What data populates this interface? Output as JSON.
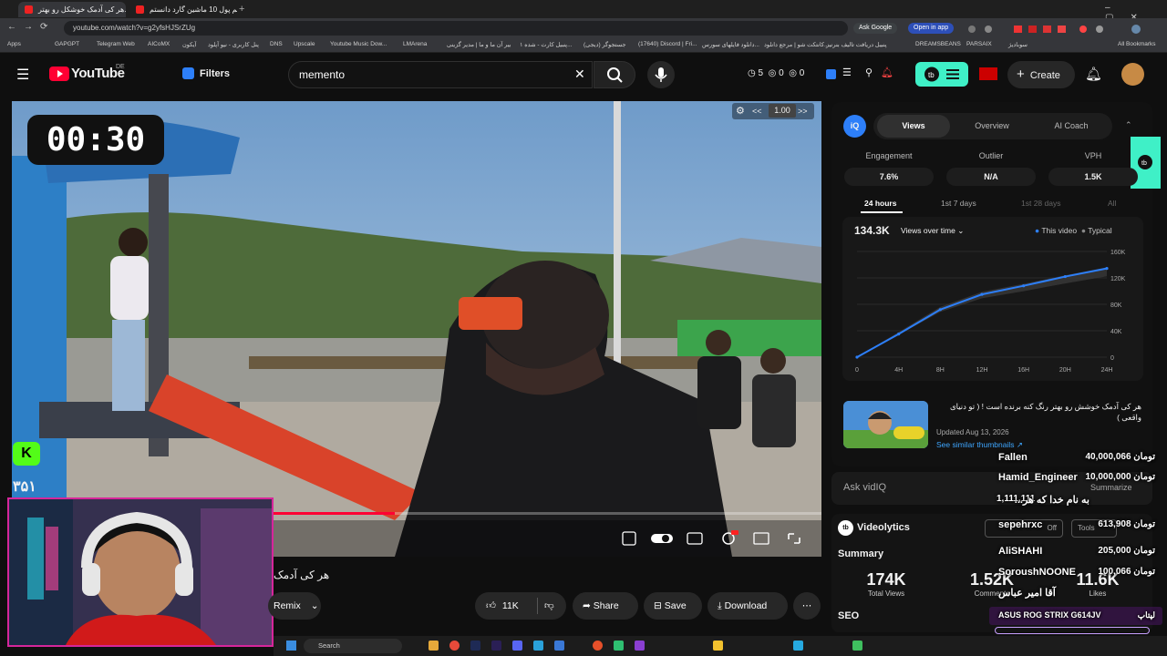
{
  "browser": {
    "tabs": [
      "هر کی آدمک خوشکل رو بهتر...",
      "بیم پول 10 ماشین گارد دانستم ..."
    ],
    "url": "youtube.com/watch?v=g2yfsHJSrZUg",
    "chips": {
      "ask_google": "Ask Google",
      "open_app": "Open in app"
    },
    "bookmarks": [
      "Apps",
      "GAPGPT",
      "Telegram Web",
      "AICoMX",
      "آیکون",
      "پنل کاربری - نیو آپلود",
      "DNS",
      "Upscale",
      "Youtube Music Dow...",
      "LMArena",
      "بیر آن ما و ما | مدیر گزینی",
      "پنبیل کارت - شده ۱...",
      "جستجوگر (دیجی)",
      "(17640) Discord | Fri...",
      "دانلود فایلهای سورس...",
      "کانتکت شو | مرجع دانلود...",
      "پنبیل دریافت تالیف بنرنیز",
      "DREAMSBEANS",
      "PARSAIX",
      "سوبادیژ",
      "All Bookmarks"
    ]
  },
  "yt": {
    "logo": "YouTube",
    "region": "DE",
    "filters": "Filters",
    "search_value": "memento",
    "stats": {
      "a": "5",
      "b": "0",
      "c": "0"
    },
    "create": "Create"
  },
  "video": {
    "timer": "00:30",
    "speed": "1.00",
    "speed_prev": "<<",
    "speed_next": ">>",
    "overlay_number": "۳۵۱",
    "title": "هر کی آدمک",
    "channel_action": "Remix"
  },
  "actions": {
    "likes": "11K",
    "share": "Share",
    "save": "Save",
    "download": "Download"
  },
  "panel": {
    "tabs": [
      "Views",
      "Overview",
      "AI Coach"
    ],
    "metrics": [
      {
        "label": "Engagement",
        "value": "7.6%"
      },
      {
        "label": "Outlier",
        "value": "N/A"
      },
      {
        "label": "VPH",
        "value": "1.5K"
      }
    ],
    "ranges": [
      "24 hours",
      "1st 7 days",
      "1st 28 days",
      "All"
    ],
    "views_total": "134.3K",
    "views_mode": "Views over time",
    "legend": {
      "this": "This video",
      "typical": "Typical"
    },
    "related_title": "هر کی آدمک خوشش رو بهتر رنگ کنه برنده است ! ( تو دنیای واقعی )",
    "updated": "Updated Aug 13, 2026",
    "similar": "See similar thumbnails ↗",
    "ask": "Ask vidIQ",
    "summarize": "Summarize",
    "videolytics": "Videolytics",
    "toggle_off": "Off",
    "tools": "Tools",
    "summary": "Summary",
    "stats": [
      {
        "value": "174K",
        "label": "Total Views"
      },
      {
        "value": "1.52K",
        "label": "Comments"
      },
      {
        "value": "11.6K",
        "label": "Likes"
      }
    ],
    "seo": "SEO"
  },
  "chart_data": {
    "type": "area",
    "x": [
      "0",
      "4H",
      "8H",
      "12H",
      "16H",
      "20H",
      "24H"
    ],
    "series": [
      {
        "name": "This video",
        "values": [
          0,
          35000,
          72000,
          95000,
          108000,
          122000,
          134300
        ]
      },
      {
        "name": "Typical",
        "values": [
          0,
          38000,
          76000,
          99000,
          111000,
          124000,
          136000
        ]
      }
    ],
    "yticks": [
      "0",
      "40K",
      "80K",
      "120K",
      "160K"
    ],
    "ylim": [
      0,
      160000
    ]
  },
  "donations": [
    {
      "name": "Fallen",
      "amount": "40,000,066 تومان"
    },
    {
      "name": "Hamid_Engineer",
      "amount": "10,000,000 تومان"
    },
    {
      "name": "به نام خدا که هر...",
      "amount": "1,111,111"
    },
    {
      "name": "sepehrxc",
      "amount": "613,908 تومان"
    },
    {
      "name": "AliSHAHI",
      "amount": "205,000 تومان"
    },
    {
      "name": "SoroushNOONE",
      "amount": "100,066 تومان"
    },
    {
      "name": "آقا امیر عباس",
      "amount": ""
    },
    {
      "name": "ASUS ROG STRIX G614JV",
      "amount": "لپتاپ"
    }
  ],
  "taskbar": {
    "search": "Search"
  },
  "colors": {
    "accent_red": "#ff0033",
    "vidiq_blue": "#2d7ff9",
    "teal": "#3ff0c7",
    "cam_border": "#d6269a"
  }
}
